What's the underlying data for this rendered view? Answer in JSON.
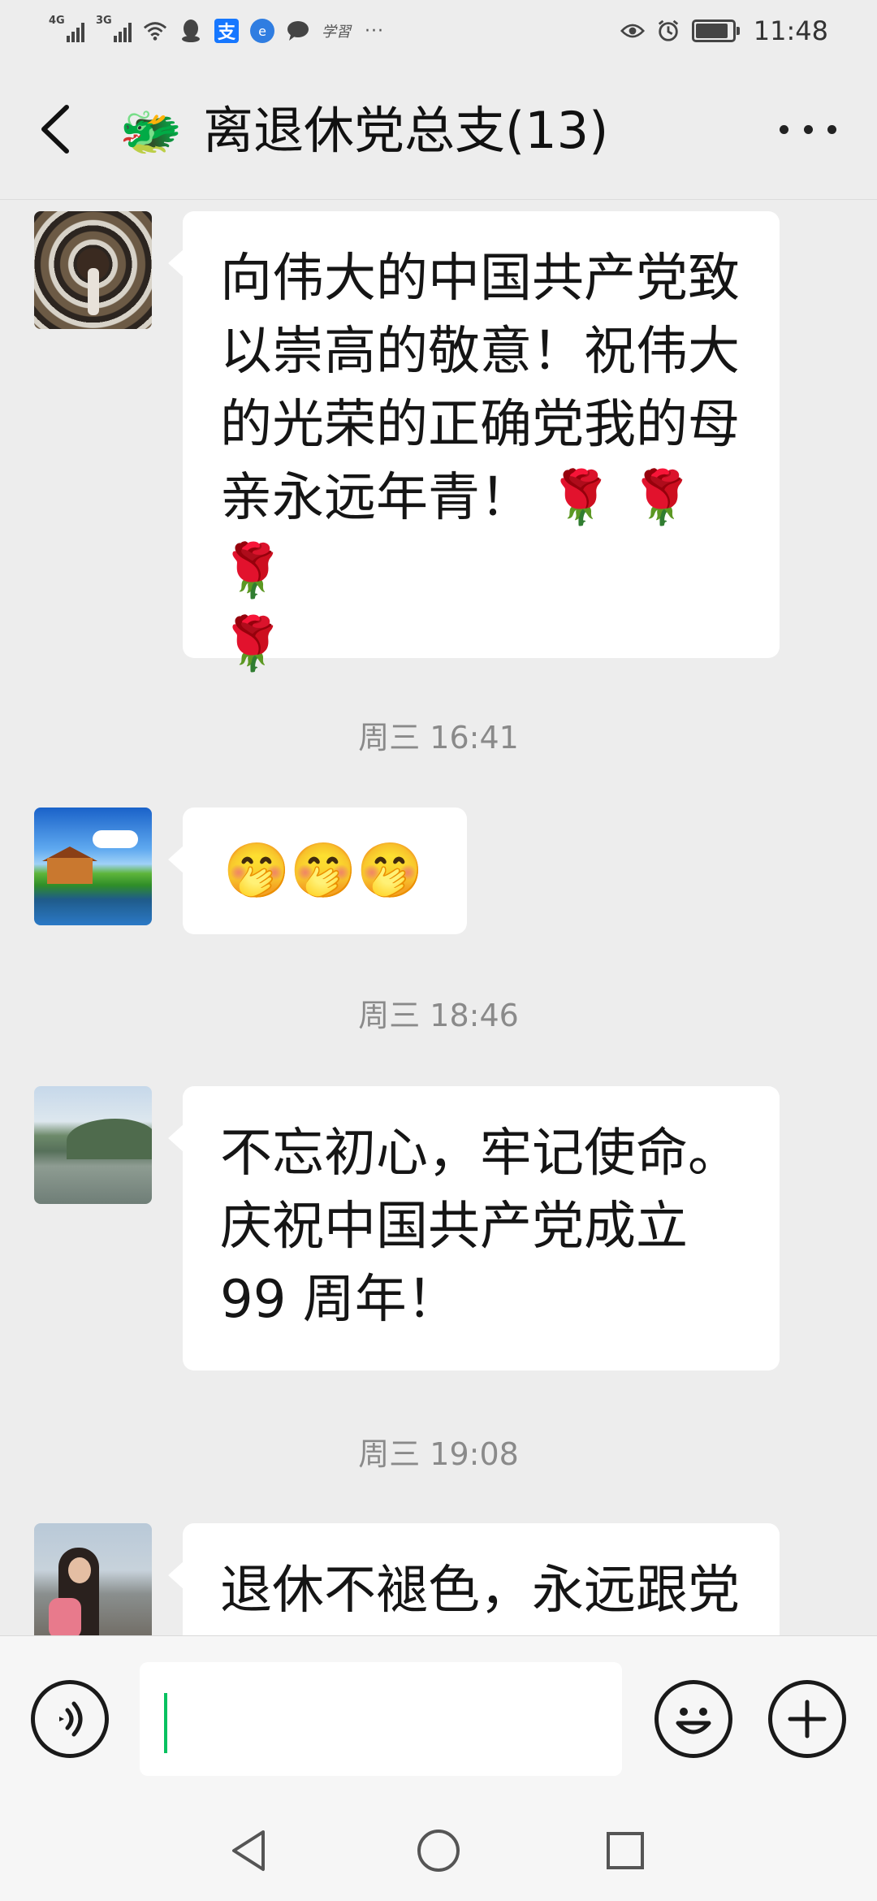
{
  "status_bar": {
    "net1": "4G",
    "net2": "3G",
    "alipay_glyph": "支",
    "study_glyph": "学習",
    "more_glyph": "···",
    "time": "11:48",
    "icons": [
      "signal-4g-icon",
      "signal-3g-icon",
      "wifi-icon",
      "qq-icon",
      "alipay-icon",
      "browser-icon",
      "message-icon",
      "study-app-icon",
      "more-notifications-icon",
      "eye-icon",
      "alarm-icon",
      "battery-icon"
    ]
  },
  "header": {
    "title": "离退休党总支(13)",
    "group_icon": "🐲",
    "back_icon": "back-arrow-icon",
    "more_icon": "more-icon"
  },
  "messages": [
    {
      "type": "text",
      "avatar": "avatar-tunnel",
      "lines": [
        "向伟大的中国共产党致",
        "以崇高的敬意！祝伟大",
        "的光荣的正确党我的母",
        "亲永远年青！ 🌹 🌹 🌹",
        "🌹"
      ]
    },
    {
      "type": "timestamp",
      "text": "周三 16:41"
    },
    {
      "type": "emoji",
      "avatar": "avatar-lakehouse",
      "text": "🤭🤭🤭"
    },
    {
      "type": "timestamp",
      "text": "周三 18:46"
    },
    {
      "type": "text",
      "avatar": "avatar-river",
      "lines": [
        "不忘初心，牢记使命。",
        "庆祝中国共产党成立",
        "99 周年！"
      ]
    },
    {
      "type": "timestamp",
      "text": "周三 19:08"
    },
    {
      "type": "text",
      "avatar": "avatar-seaside",
      "lines": [
        "退休不褪色，永远跟党"
      ]
    }
  ],
  "input_bar": {
    "value": "",
    "voice_icon": "voice-icon",
    "emoji_icon": "emoji-icon",
    "plus_icon": "plus-icon"
  },
  "nav_bar": {
    "icons": [
      "nav-back-icon",
      "nav-home-icon",
      "nav-recent-icon"
    ]
  },
  "colors": {
    "background": "#ededed",
    "bubble": "#ffffff",
    "timestamp": "#8a8a8a",
    "caret": "#07c160"
  }
}
